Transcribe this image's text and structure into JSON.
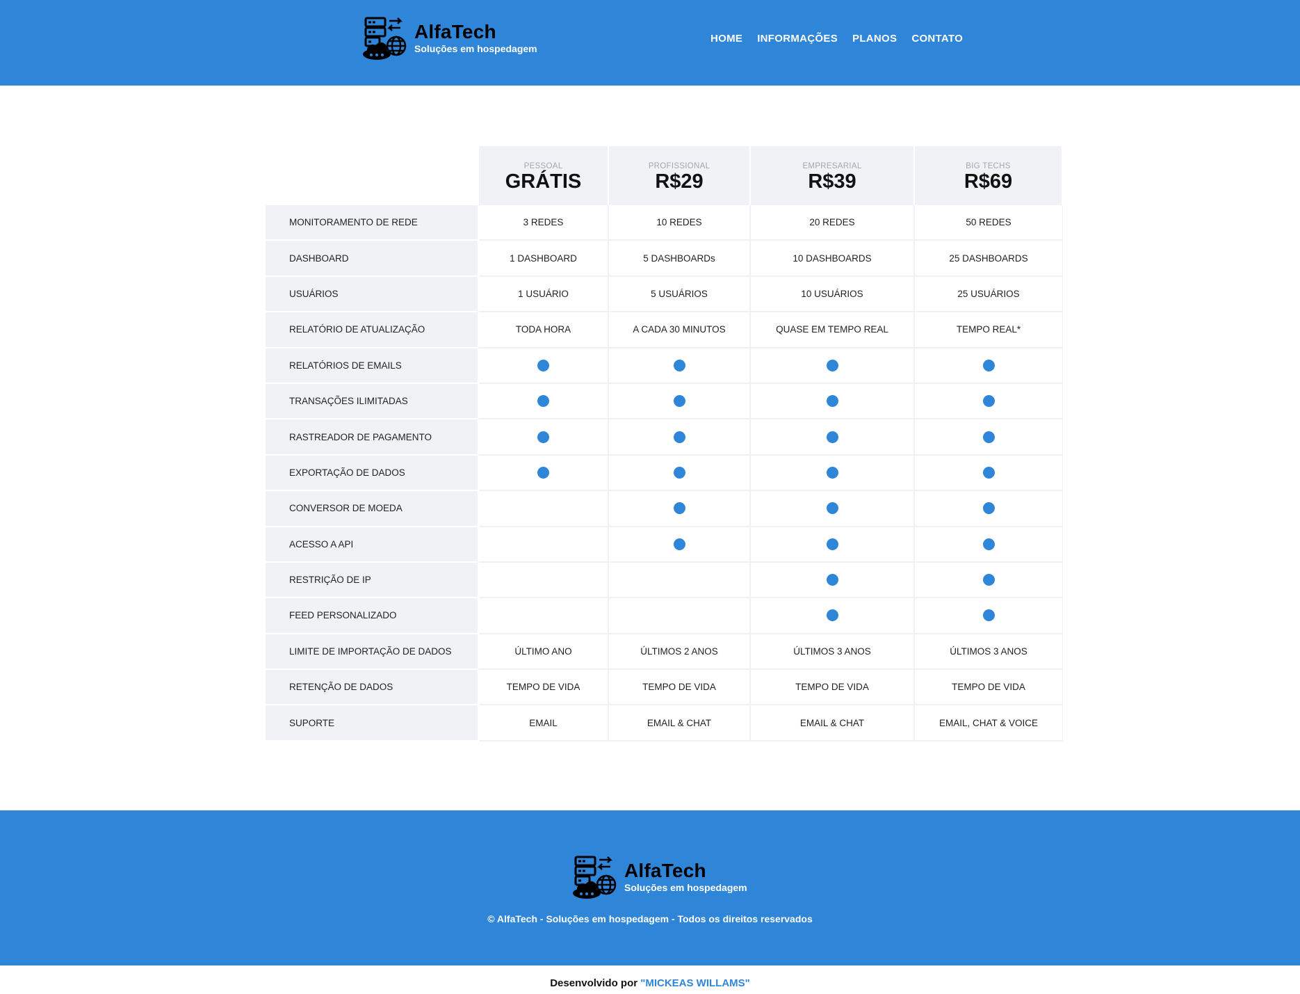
{
  "brand": {
    "name": "AlfaTech",
    "tagline": "Soluções em hospedagem",
    "accent_color": "#2f86d8",
    "logo_icon": "server-cloud-globe-icon"
  },
  "nav": {
    "items": [
      "HOME",
      "INFORMAÇÕES",
      "PLANOS",
      "CONTATO"
    ]
  },
  "plans": [
    {
      "name": "PESSOAL",
      "price": "GRÁTIS"
    },
    {
      "name": "PROFISSIONAL",
      "price": "R$29"
    },
    {
      "name": "EMPRESARIAL",
      "price": "R$39"
    },
    {
      "name": "BIG TECHS",
      "price": "R$69"
    }
  ],
  "features": [
    {
      "label": "MONITORAMENTO DE REDE",
      "values": [
        "3 REDES",
        "10 REDES",
        "20 REDES",
        "50 REDES"
      ]
    },
    {
      "label": "DASHBOARD",
      "values": [
        "1 DASHBOARD",
        "5 DASHBOARDs",
        "10 DASHBOARDS",
        "25 DASHBOARDS"
      ]
    },
    {
      "label": "USUÁRIOS",
      "values": [
        "1 USUÁRIO",
        "5 USUÁRIOS",
        "10 USUÁRIOS",
        "25 USUÁRIOS"
      ]
    },
    {
      "label": "RELATÓRIO DE ATUALIZAÇÃO",
      "values": [
        "TODA HORA",
        "A CADA 30 MINUTOS",
        "QUASE EM TEMPO REAL",
        "TEMPO REAL*"
      ]
    },
    {
      "label": "RELATÓRIOS DE EMAILS",
      "values": [
        true,
        true,
        true,
        true
      ]
    },
    {
      "label": "TRANSAÇÕES ILIMITADAS",
      "values": [
        true,
        true,
        true,
        true
      ]
    },
    {
      "label": "RASTREADOR DE PAGAMENTO",
      "values": [
        true,
        true,
        true,
        true
      ]
    },
    {
      "label": "EXPORTAÇÃO DE DADOS",
      "values": [
        true,
        true,
        true,
        true
      ]
    },
    {
      "label": "CONVERSOR DE MOEDA",
      "values": [
        false,
        true,
        true,
        true
      ]
    },
    {
      "label": "ACESSO A API",
      "values": [
        false,
        true,
        true,
        true
      ]
    },
    {
      "label": "RESTRIÇÃO DE IP",
      "values": [
        false,
        false,
        true,
        true
      ]
    },
    {
      "label": "FEED PERSONALIZADO",
      "values": [
        false,
        false,
        true,
        true
      ]
    },
    {
      "label": "LIMITE DE IMPORTAÇÃO DE DADOS",
      "values": [
        "ÚLTIMO ANO",
        "ÚLTIMOS 2 ANOS",
        "ÚLTIMOS 3 ANOS",
        "ÚLTIMOS 3 ANOS"
      ]
    },
    {
      "label": "RETENÇÃO DE DADOS",
      "values": [
        "TEMPO DE VIDA",
        "TEMPO DE VIDA",
        "TEMPO DE VIDA",
        "TEMPO DE VIDA"
      ]
    },
    {
      "label": "SUPORTE",
      "values": [
        "EMAIL",
        "EMAIL & CHAT",
        "EMAIL & CHAT",
        "EMAIL, CHAT & VOICE"
      ]
    }
  ],
  "footer": {
    "copyright": "© AlfaTech - Soluções em hospedagem - Todos os direitos reservados",
    "credits_prefix": "Desenvolvido por ",
    "credits_author": "\"MICKEAS WILLAMS\""
  }
}
